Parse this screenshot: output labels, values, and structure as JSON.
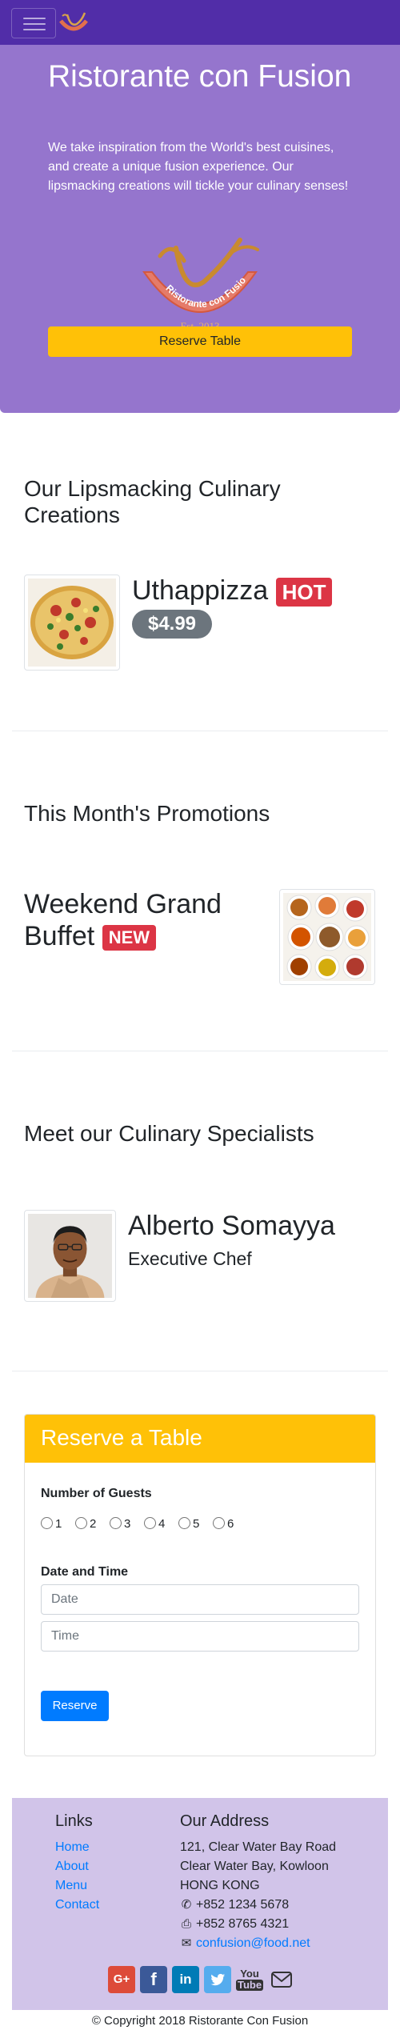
{
  "navbar": {
    "toggle_icon": "hamburger-menu-icon",
    "logo": "ristorante-con-fusion-logo"
  },
  "jumbotron": {
    "title": "Ristorante con Fusion",
    "text": "We take inspiration from the World's best cuisines, and create a unique fusion experience. Our lipsmacking creations will tickle your culinary senses!",
    "logo_ribbon_text": "Ristorante con Fusion",
    "logo_est_text": "Est. 2013",
    "reserve_button": "Reserve Table"
  },
  "creations": {
    "heading": "Our Lipsmacking Culinary Creations",
    "dish_name": "Uthappizza",
    "badge": "HOT",
    "price": "$4.99"
  },
  "promotions": {
    "heading": "This Month's Promotions",
    "name": "Weekend Grand Buffet",
    "badge": "NEW"
  },
  "specialists": {
    "heading": "Meet our Culinary Specialists",
    "name": "Alberto Somayya",
    "role": "Executive Chef"
  },
  "reservation": {
    "title": "Reserve a Table",
    "guests_label": "Number of Guests",
    "guest_options": [
      "1",
      "2",
      "3",
      "4",
      "5",
      "6"
    ],
    "datetime_label": "Date and Time",
    "date_placeholder": "Date",
    "time_placeholder": "Time",
    "submit_label": "Reserve"
  },
  "footer": {
    "links_heading": "Links",
    "links": [
      "Home",
      "About",
      "Menu",
      "Contact"
    ],
    "address_heading": "Our Address",
    "address_lines": [
      "121, Clear Water Bay Road",
      "Clear Water Bay, Kowloon",
      "HONG KONG"
    ],
    "phone": "+852 1234 5678",
    "fax": "+852 8765 4321",
    "email": "confusion@food.net",
    "social": [
      {
        "icon": "google-plus-icon",
        "color": "#dd4b39"
      },
      {
        "icon": "facebook-icon",
        "color": "#3b5998"
      },
      {
        "icon": "linkedin-icon",
        "color": "#007bb6"
      },
      {
        "icon": "twitter-icon",
        "color": "#55acee"
      },
      {
        "icon": "youtube-icon",
        "color": "#333333"
      },
      {
        "icon": "mail-icon",
        "color": "#333333"
      }
    ],
    "copyright": "© Copyright 2018 Ristorante Con Fusion"
  },
  "colors": {
    "navbar": "#512da8",
    "jumbotron": "#9575cd",
    "accent": "#ffc107",
    "footer": "#d1c4e9",
    "danger": "#dc3545",
    "primary": "#007bff"
  }
}
